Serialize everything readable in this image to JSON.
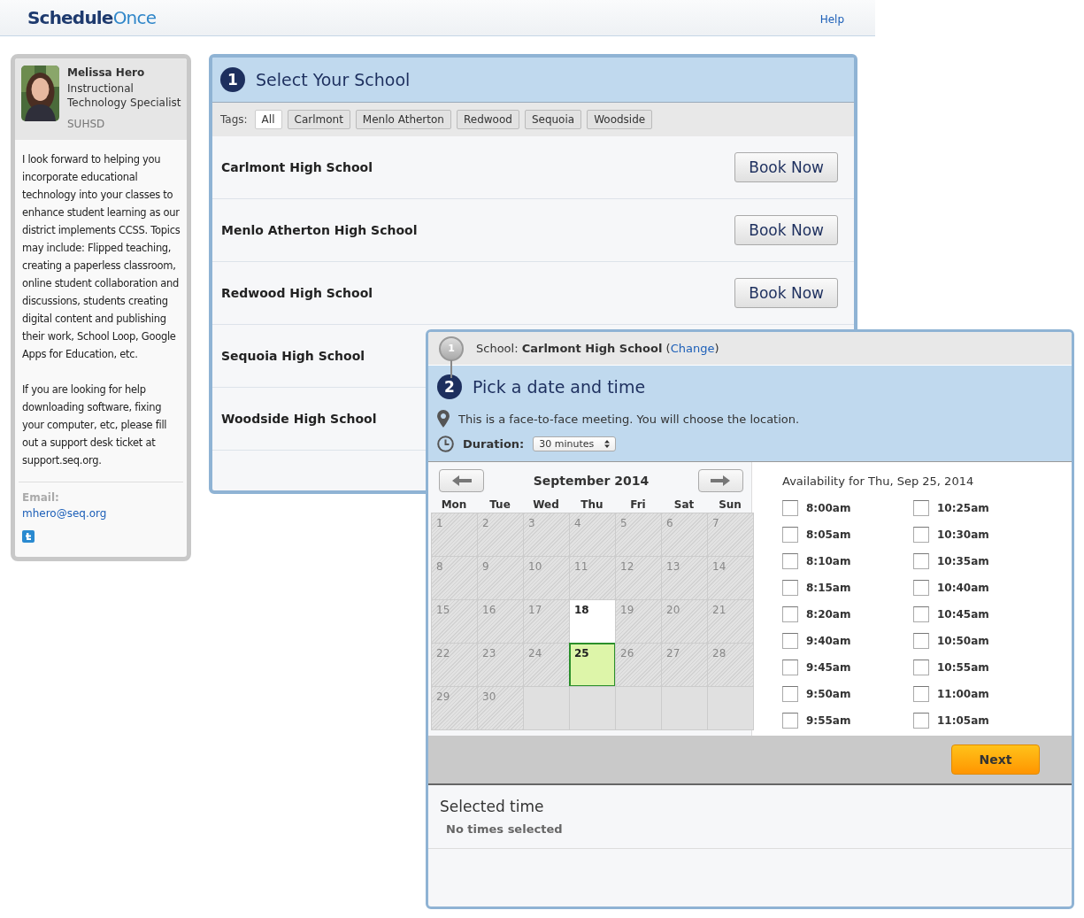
{
  "header": {
    "logo_dark": "Schedule",
    "logo_light": "Once",
    "help": "Help"
  },
  "profile": {
    "name": "Melissa Hero",
    "title": "Instructional Technology Specialist",
    "organization": "SUHSD",
    "bio": [
      "I look forward to helping you incorporate educational technology into your classes to enhance student learning as our district implements CCSS. Topics may include: Flipped teaching, creating a paperless classroom, online student collaboration and discussions, students creating digital content and publishing their work, School Loop, Google Apps for Education, etc.",
      "If you are looking for help downloading software, fixing your computer, etc, please fill out a support desk ticket at support.seq.org."
    ],
    "email_label": "Email:",
    "email": "mhero@seq.org"
  },
  "step1": {
    "number": "1",
    "title": "Select Your School",
    "tags_label": "Tags:",
    "tags": [
      {
        "label": "All",
        "selected": true
      },
      {
        "label": "Carlmont",
        "selected": false
      },
      {
        "label": "Menlo Atherton",
        "selected": false
      },
      {
        "label": "Redwood",
        "selected": false
      },
      {
        "label": "Sequoia",
        "selected": false
      },
      {
        "label": "Woodside",
        "selected": false
      }
    ],
    "schools": [
      {
        "name": "Carlmont High School",
        "button": "Book Now"
      },
      {
        "name": "Menlo Atherton High School",
        "button": "Book Now"
      },
      {
        "name": "Redwood High School",
        "button": "Book Now"
      },
      {
        "name": "Sequoia High School"
      },
      {
        "name": "Woodside High School"
      }
    ]
  },
  "step2": {
    "done_step": {
      "number": "1",
      "label": "School:",
      "value": "Carlmont High School",
      "link_open": "(",
      "link": "Change",
      "link_close": ")"
    },
    "number": "2",
    "title": "Pick a date and time",
    "location_note": "This is a face-to-face meeting. You will choose the location.",
    "duration_label": "Duration:",
    "duration": "30 minutes",
    "calendar": {
      "month": "September 2014",
      "weekdays": [
        "Mon",
        "Tue",
        "Wed",
        "Thu",
        "Fri",
        "Sat",
        "Sun"
      ],
      "days": [
        {
          "day": "1",
          "available": false,
          "selected": false
        },
        {
          "day": "2",
          "available": false,
          "selected": false
        },
        {
          "day": "3",
          "available": false,
          "selected": false
        },
        {
          "day": "4",
          "available": false,
          "selected": false
        },
        {
          "day": "5",
          "available": false,
          "selected": false
        },
        {
          "day": "6",
          "available": false,
          "selected": false
        },
        {
          "day": "7",
          "available": false,
          "selected": false
        },
        {
          "day": "8",
          "available": false,
          "selected": false
        },
        {
          "day": "9",
          "available": false,
          "selected": false
        },
        {
          "day": "10",
          "available": false,
          "selected": false
        },
        {
          "day": "11",
          "available": false,
          "selected": false
        },
        {
          "day": "12",
          "available": false,
          "selected": false
        },
        {
          "day": "13",
          "available": false,
          "selected": false
        },
        {
          "day": "14",
          "available": false,
          "selected": false
        },
        {
          "day": "15",
          "available": false,
          "selected": false
        },
        {
          "day": "16",
          "available": false,
          "selected": false
        },
        {
          "day": "17",
          "available": false,
          "selected": false
        },
        {
          "day": "18",
          "available": true,
          "selected": false
        },
        {
          "day": "19",
          "available": false,
          "selected": false
        },
        {
          "day": "20",
          "available": false,
          "selected": false
        },
        {
          "day": "21",
          "available": false,
          "selected": false
        },
        {
          "day": "22",
          "available": false,
          "selected": false
        },
        {
          "day": "23",
          "available": false,
          "selected": false
        },
        {
          "day": "24",
          "available": false,
          "selected": false
        },
        {
          "day": "25",
          "available": true,
          "selected": true
        },
        {
          "day": "26",
          "available": false,
          "selected": false
        },
        {
          "day": "27",
          "available": false,
          "selected": false
        },
        {
          "day": "28",
          "available": false,
          "selected": false
        },
        {
          "day": "29",
          "available": false,
          "selected": false
        },
        {
          "day": "30",
          "available": false,
          "selected": false
        }
      ]
    },
    "availability_title": "Availability for Thu, Sep 25, 2014",
    "slots": [
      {
        "time": "8:00am",
        "checked": false
      },
      {
        "time": "8:05am",
        "checked": false
      },
      {
        "time": "8:10am",
        "checked": false
      },
      {
        "time": "8:15am",
        "checked": false
      },
      {
        "time": "8:20am",
        "checked": false
      },
      {
        "time": "9:40am",
        "checked": false
      },
      {
        "time": "9:45am",
        "checked": false
      },
      {
        "time": "9:50am",
        "checked": false
      },
      {
        "time": "9:55am",
        "checked": false
      },
      {
        "time": "10:25am",
        "checked": false
      },
      {
        "time": "10:30am",
        "checked": false
      },
      {
        "time": "10:35am",
        "checked": false
      },
      {
        "time": "10:40am",
        "checked": false
      },
      {
        "time": "10:45am",
        "checked": false
      },
      {
        "time": "10:50am",
        "checked": false
      },
      {
        "time": "10:55am",
        "checked": false
      },
      {
        "time": "11:00am",
        "checked": false
      },
      {
        "time": "11:05am",
        "checked": false
      }
    ],
    "next": "Next",
    "selected_title": "Selected time",
    "selected_empty": "No times selected"
  }
}
